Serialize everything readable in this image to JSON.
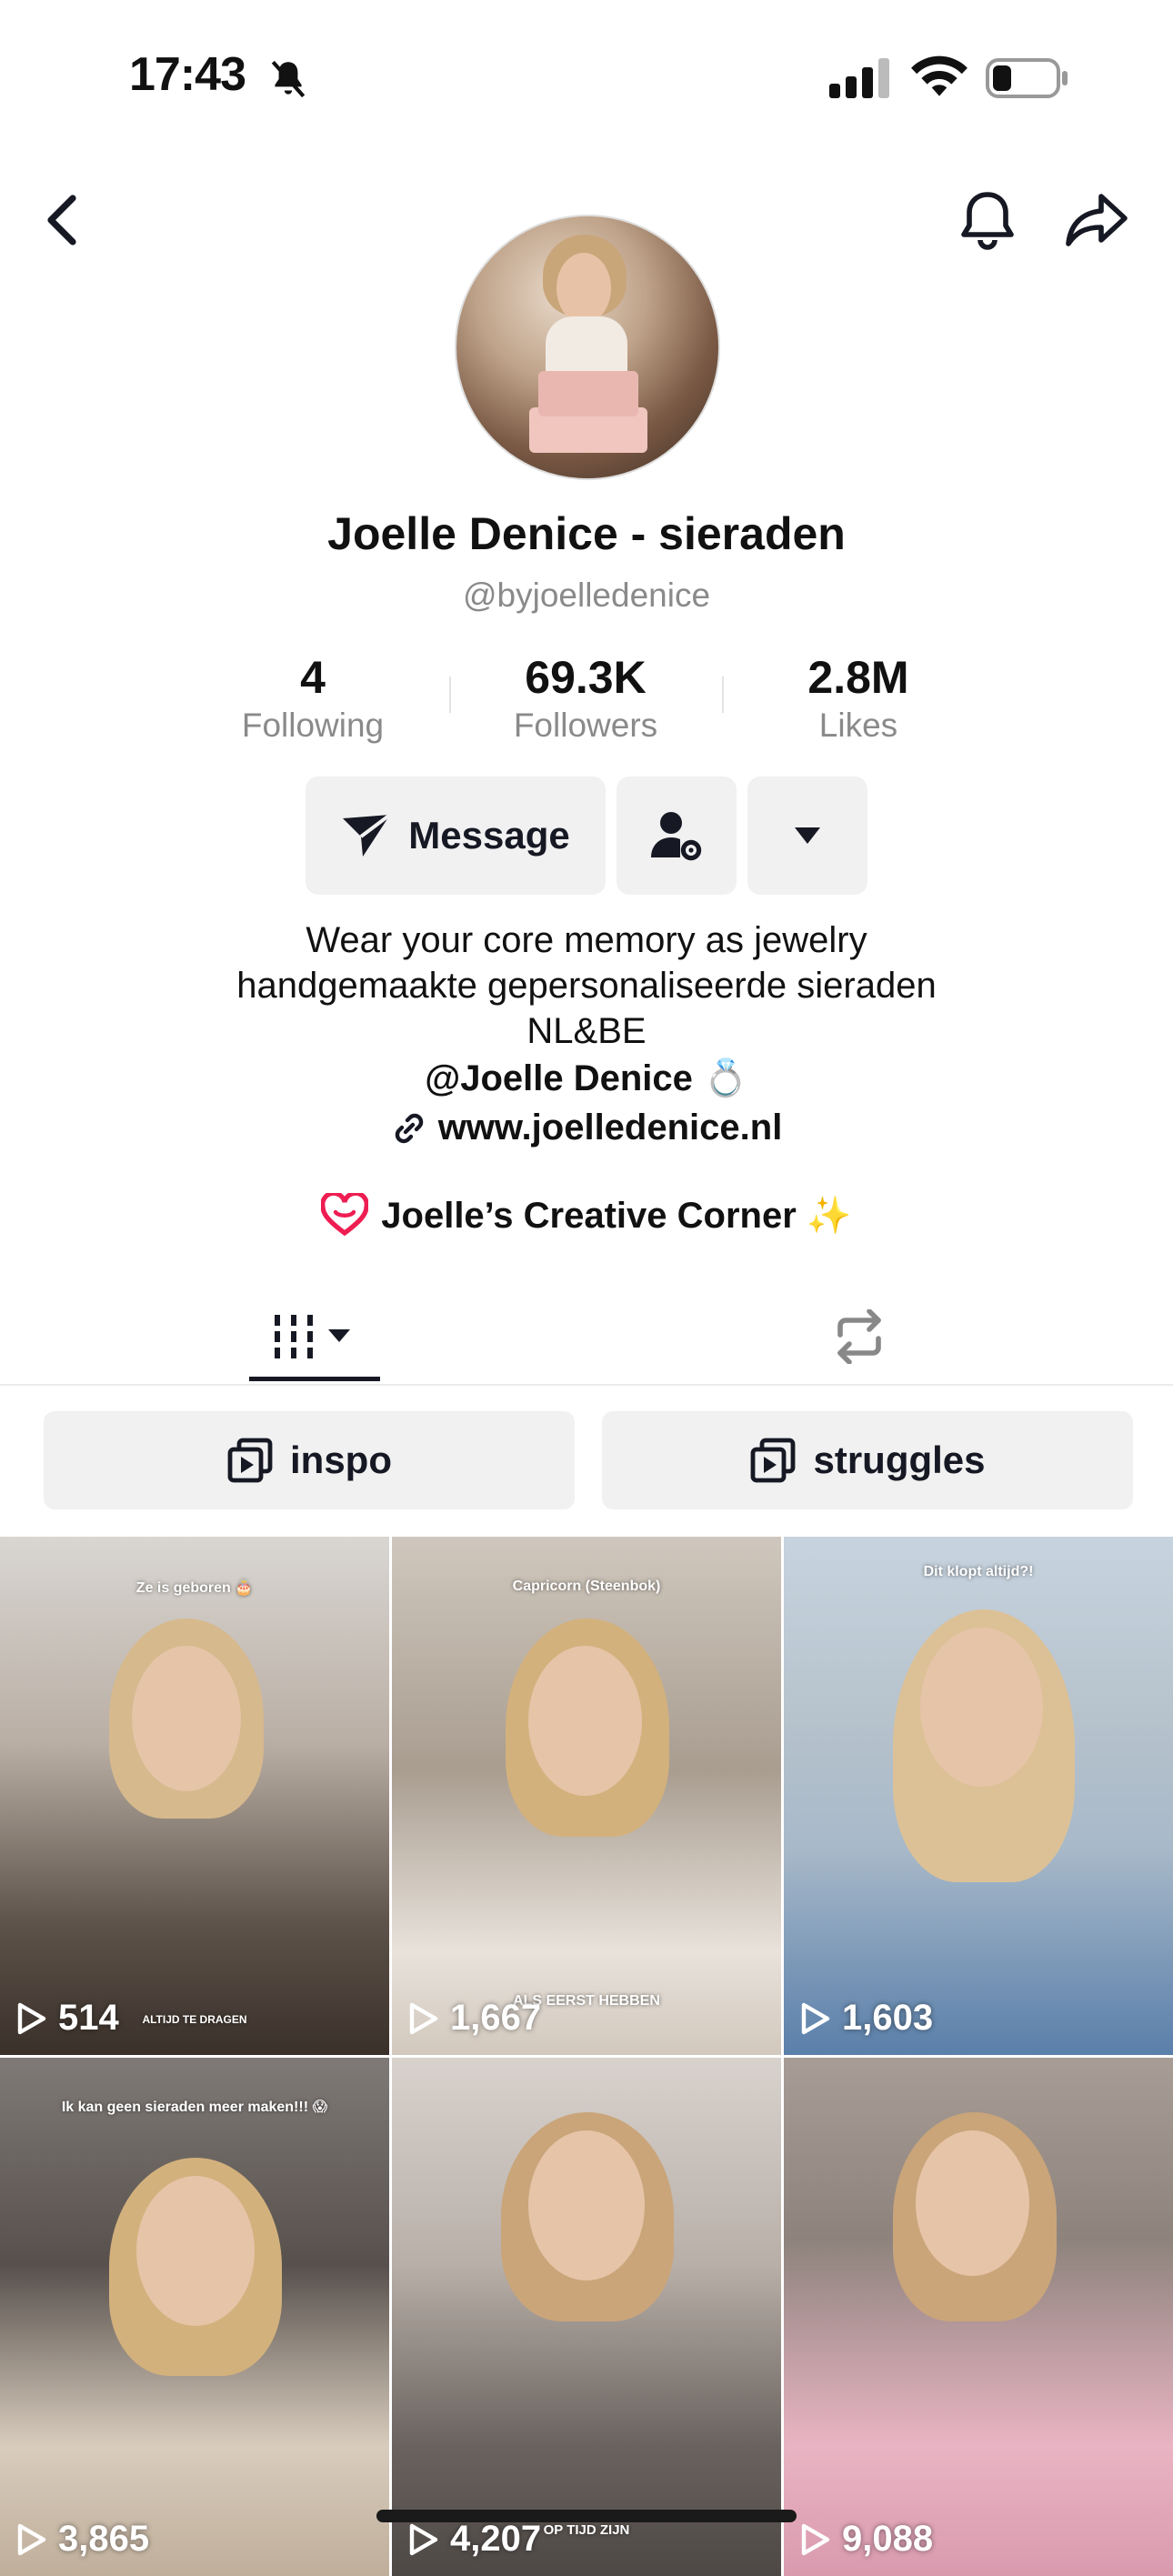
{
  "status_bar": {
    "time": "17:43"
  },
  "profile": {
    "name": "Joelle Denice - sieraden",
    "handle": "@byjoelledenice",
    "stats": [
      {
        "value": "4",
        "label": "Following"
      },
      {
        "value": "69.3K",
        "label": "Followers"
      },
      {
        "value": "2.8M",
        "label": "Likes"
      }
    ],
    "message_label": "Message",
    "bio_lines": [
      "Wear your core memory as jewelry",
      "handgemaakte gepersonaliseerde sieraden",
      "NL&BE"
    ],
    "mention": "@Joelle Denice 💍",
    "link": "www.joelledenice.nl",
    "creative_corner": "Joelle’s Creative Corner ✨"
  },
  "playlists": [
    {
      "label": "inspo"
    },
    {
      "label": "struggles"
    }
  ],
  "videos": [
    {
      "views": "514",
      "caption_top": "Ze is geboren 🎂",
      "caption_bottom": "ALTIJD TE DRAGEN"
    },
    {
      "views": "1,667",
      "caption_top": "Capricorn (Steenbok)",
      "caption_bottom": "ALS EERST HEBBEN"
    },
    {
      "views": "1,603",
      "caption_top": "Dit klopt altijd?!",
      "caption_bottom": ""
    },
    {
      "views": "3,865",
      "caption_top": "Ik kan geen sieraden meer maken!!! 😱",
      "caption_bottom": ""
    },
    {
      "views": "4,207",
      "caption_top": "",
      "caption_bottom": "OP TIJD ZIJN"
    },
    {
      "views": "9,088",
      "caption_top": "",
      "caption_bottom": ""
    }
  ],
  "icons": {
    "back": "chevron-left-icon",
    "notification": "bell-icon",
    "share": "share-arrow-icon",
    "message": "paper-plane-icon",
    "follow": "user-gear-icon",
    "more": "caret-down-icon",
    "grid_tab": "grid-columns-icon",
    "repost_tab": "repost-icon",
    "playlist": "playlist-icon",
    "play": "play-icon"
  },
  "colors": {
    "accent_dark": "#161823",
    "muted": "#8a8a8a",
    "button_bg": "#f1f1f2"
  }
}
